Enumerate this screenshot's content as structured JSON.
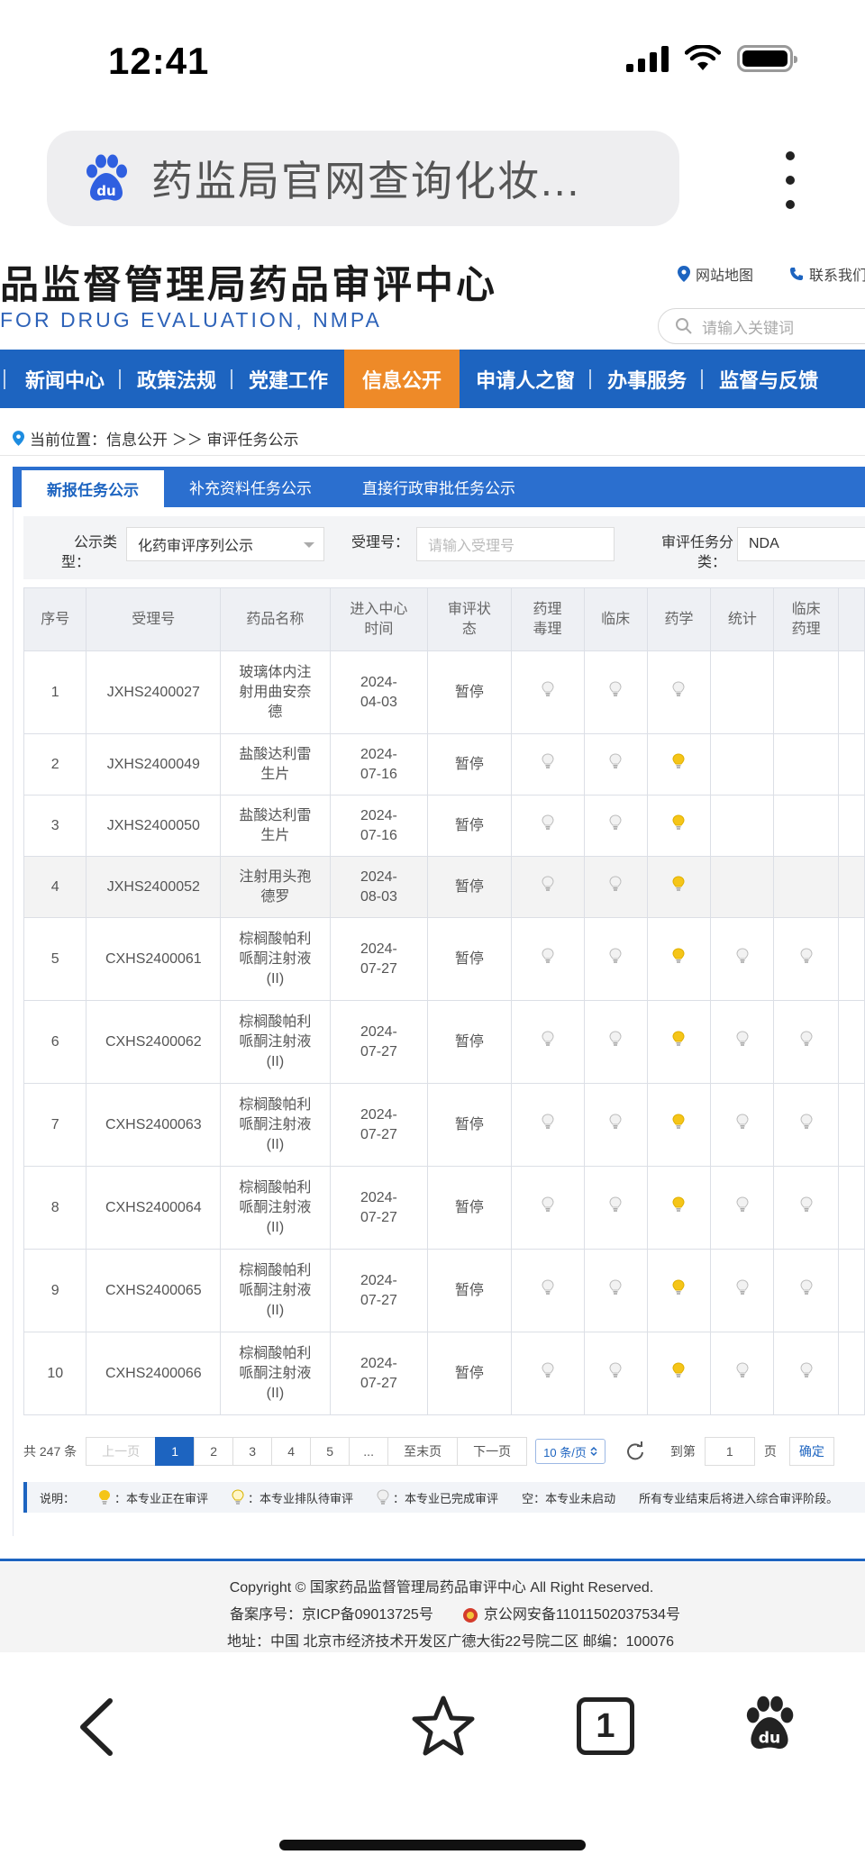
{
  "status_bar": {
    "time": "12:41"
  },
  "browser": {
    "search_query": "药监局官网查询化妆...",
    "tab_count": "1"
  },
  "site": {
    "title": "品监督管理局药品审评中心",
    "subtitle": "FOR DRUG EVALUATION, NMPA",
    "link_sitemap": "网站地图",
    "link_contact": "联系我们",
    "search_placeholder": "请输入关键词"
  },
  "nav": {
    "items": [
      {
        "label": "新闻中心"
      },
      {
        "label": "政策法规"
      },
      {
        "label": "党建工作"
      },
      {
        "label": "信息公开",
        "active": true
      },
      {
        "label": "申请人之窗"
      },
      {
        "label": "办事服务"
      },
      {
        "label": "监督与反馈"
      }
    ]
  },
  "breadcrumb": "当前位置：信息公开 ＞＞ 审评任务公示",
  "tabs": [
    {
      "label": "新报任务公示",
      "active": true
    },
    {
      "label": "补充资料任务公示"
    },
    {
      "label": "直接行政审批任务公示"
    }
  ],
  "filter": {
    "type_label_1": "公示类",
    "type_label_2": "型：",
    "type_value": "化药审评序列公示",
    "accept_label": "受理号：",
    "accept_placeholder": "请输入受理号",
    "category_label_1": "审评任务分",
    "category_label_2": "类：",
    "category_value": "NDA"
  },
  "table": {
    "headers": [
      "序号",
      "受理号",
      "药品名称",
      "进入中心时间",
      "审评状态",
      "药理毒理",
      "临床",
      "药学",
      "统计",
      "临床药理"
    ],
    "rows": [
      {
        "no": "1",
        "id": "JXHS2400027",
        "name": "玻璃体内注射用曲安奈德",
        "date": "2024-04-03",
        "status": "暂停",
        "lights": [
          "done",
          "done",
          "done",
          "",
          ""
        ]
      },
      {
        "no": "2",
        "id": "JXHS2400049",
        "name": "盐酸达利雷生片",
        "date": "2024-07-16",
        "status": "暂停",
        "lights": [
          "done",
          "done",
          "active",
          "",
          ""
        ]
      },
      {
        "no": "3",
        "id": "JXHS2400050",
        "name": "盐酸达利雷生片",
        "date": "2024-07-16",
        "status": "暂停",
        "lights": [
          "done",
          "done",
          "active",
          "",
          ""
        ]
      },
      {
        "no": "4",
        "id": "JXHS2400052",
        "name": "注射用头孢德罗",
        "date": "2024-08-03",
        "status": "暂停",
        "lights": [
          "done",
          "done",
          "active",
          "",
          ""
        ]
      },
      {
        "no": "5",
        "id": "CXHS2400061",
        "name": "棕榈酸帕利哌酮注射液(II)",
        "date": "2024-07-27",
        "status": "暂停",
        "lights": [
          "done",
          "done",
          "active",
          "done",
          "done"
        ]
      },
      {
        "no": "6",
        "id": "CXHS2400062",
        "name": "棕榈酸帕利哌酮注射液(II)",
        "date": "2024-07-27",
        "status": "暂停",
        "lights": [
          "done",
          "done",
          "active",
          "done",
          "done"
        ]
      },
      {
        "no": "7",
        "id": "CXHS2400063",
        "name": "棕榈酸帕利哌酮注射液(II)",
        "date": "2024-07-27",
        "status": "暂停",
        "lights": [
          "done",
          "done",
          "active",
          "done",
          "done"
        ]
      },
      {
        "no": "8",
        "id": "CXHS2400064",
        "name": "棕榈酸帕利哌酮注射液(II)",
        "date": "2024-07-27",
        "status": "暂停",
        "lights": [
          "done",
          "done",
          "active",
          "done",
          "done"
        ]
      },
      {
        "no": "9",
        "id": "CXHS2400065",
        "name": "棕榈酸帕利哌酮注射液(II)",
        "date": "2024-07-27",
        "status": "暂停",
        "lights": [
          "done",
          "done",
          "active",
          "done",
          "done"
        ]
      },
      {
        "no": "10",
        "id": "CXHS2400066",
        "name": "棕榈酸帕利哌酮注射液(II)",
        "date": "2024-07-27",
        "status": "暂停",
        "lights": [
          "done",
          "done",
          "active",
          "done",
          "done"
        ]
      }
    ]
  },
  "pagination": {
    "total": "共 247 条",
    "prev": "上一页",
    "pages": [
      "1",
      "2",
      "3",
      "4",
      "5",
      "..."
    ],
    "current": "1",
    "last": "至末页",
    "next": "下一页",
    "page_size": "10 条/页",
    "goto_label": "到第",
    "goto_value": "1",
    "page_unit": "页",
    "confirm": "确定"
  },
  "legend": {
    "title": "说明：",
    "active": "：本专业正在审评",
    "queued": "：本专业排队待审评",
    "done": "：本专业已完成审评",
    "empty": "空：本专业未启动",
    "note": "所有专业结束后将进入综合审评阶段。"
  },
  "footer": {
    "copyright": "Copyright © 国家药品监督管理局药品审评中心    All Right Reserved.",
    "icp": "备案序号：京ICP备09013725号",
    "police": "京公网安备11011502037534号",
    "address": "地址：中国 北京市经济技术开发区广德大街22号院二区      邮编：100076"
  },
  "colors": {
    "brand_blue": "#1d64c0",
    "active_orange": "#ee8a28",
    "bulb_active": "#f5c518",
    "bulb_done": "#c9c9c9"
  }
}
